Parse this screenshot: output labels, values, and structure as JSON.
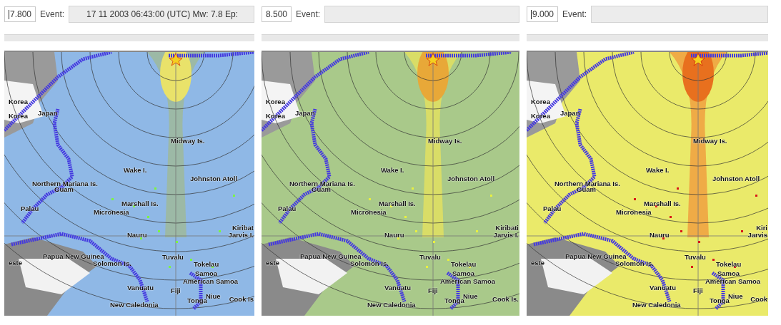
{
  "panels": [
    {
      "magnitude": "7.800",
      "focused": true,
      "event_label": "Event:",
      "event_value": "17 11 2003 06:43:00 (UTC)  Mw: 7.8 Ep:",
      "kind": "low",
      "place_labels": [
        "Korea",
        "Korea",
        "Japan",
        "Midway Is.",
        "Wake I.",
        "Johnston Atoll",
        "Northern Mariana Is.",
        "Guam",
        "Palau",
        "Marshall Is.",
        "Micronesia",
        "Nauru",
        "Kiribat",
        "Jarvis I.",
        "este",
        "Papua New Guinea",
        "Solomon Is.",
        "Tuvalu",
        "Tokelau",
        "Samoa",
        "American Samoa",
        "Vanuatu",
        "Fiji",
        "Niue",
        "Tonga",
        "Cook Is",
        "New Caledonia"
      ]
    },
    {
      "magnitude": "8.500",
      "focused": false,
      "event_label": "Event:",
      "kind": "medium",
      "place_labels": [
        "Korea",
        "Korea",
        "Japan",
        "Midway Is.",
        "Wake I.",
        "Johnston Atoll",
        "Northern Mariana Is.",
        "Guam",
        "Palau",
        "Marshall Is.",
        "Micronesia",
        "Nauru",
        "Kiribati",
        "Jarvis I.",
        "este",
        "Papua New Guinea",
        "Solomon Is.",
        "Tuvalu",
        "Tokelau",
        "Samoa",
        "American Samoa",
        "Vanuatu",
        "Fiji",
        "Niue",
        "Tonga",
        "Cook Is.",
        "New Caledonia"
      ]
    },
    {
      "magnitude": "9.000",
      "focused": true,
      "event_label": "Event:",
      "kind": "high",
      "place_labels": [
        "Korea",
        "Korea",
        "Japan",
        "Midway Is.",
        "Wake I.",
        "Johnston Atoll",
        "Northern Mariana Is.",
        "Guam",
        "Palau",
        "Marshall Is.",
        "Micronesia",
        "Nauru",
        "Kiri",
        "Jarvis",
        "este",
        "Papua New Guinea",
        "Solomon Is.",
        "Tuvalu",
        "Tokelau",
        "Samoa",
        "American Samoa",
        "Vanuatu",
        "Fiji",
        "Niue",
        "Tonga",
        "Cook",
        "New Caledonia"
      ]
    }
  ]
}
